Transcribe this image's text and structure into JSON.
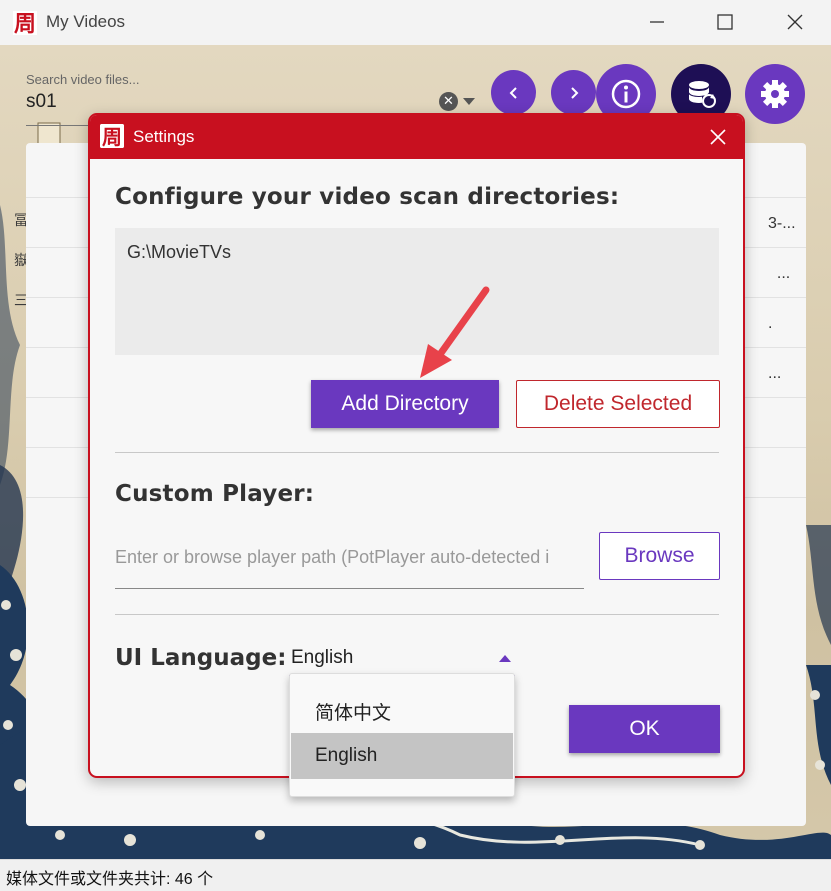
{
  "window": {
    "title": "My Videos",
    "logo_glyph": "周"
  },
  "search": {
    "label": "Search video files...",
    "value": "s01",
    "clear_glyph": "✕"
  },
  "list_fragments": [
    "3-...",
    "  ...",
    ".",
    "..."
  ],
  "status_bar": {
    "text": "媒体文件或文件夹共计: 46 个"
  },
  "dialog": {
    "title": "Settings",
    "scan_heading": "Configure your video scan directories:",
    "directories": [
      "G:\\MovieTVs"
    ],
    "add_directory_label": "Add Directory",
    "delete_selected_label": "Delete Selected",
    "player_heading": "Custom Player:",
    "player_placeholder": "Enter or browse player path (PotPlayer auto-detected i",
    "browse_label": "Browse",
    "language_label": "UI Language:",
    "language_selected": "English",
    "language_options": [
      "简体中文",
      "English"
    ],
    "ok_label": "OK"
  },
  "colors": {
    "accent_purple": "#6a38bf",
    "dialog_red": "#c8101f",
    "delete_red": "#c0272d",
    "arrow_red": "#e8424a"
  }
}
